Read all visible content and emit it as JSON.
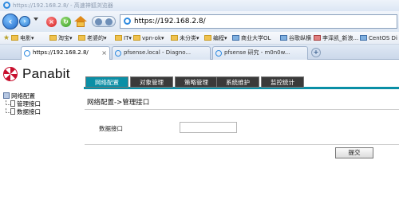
{
  "window": {
    "title": "https://192.168.2.8/ - 高速神狐浏览器"
  },
  "nav": {
    "address": "https://192.168.2.8/"
  },
  "bookmarks": [
    {
      "label": "电影",
      "type": "folder"
    },
    {
      "label": "淘宝",
      "type": "folder"
    },
    {
      "label": "老婆的",
      "type": "folder"
    },
    {
      "label": "IT",
      "type": "folder"
    },
    {
      "label": "vpn-ok",
      "type": "folder"
    },
    {
      "label": "未分类",
      "type": "folder"
    },
    {
      "label": "编程",
      "type": "folder"
    },
    {
      "label": "商业大学OL",
      "type": "link"
    },
    {
      "label": "谷歌纵横",
      "type": "link"
    },
    {
      "label": "李泽凯_新浪...",
      "type": "link"
    },
    {
      "label": "CentOS Di",
      "type": "link"
    }
  ],
  "tabs": [
    {
      "label": "https://192.168.2.8/",
      "active": true
    },
    {
      "label": "pfsense.local - Diagno...",
      "active": false
    },
    {
      "label": "pfsense 研究 - m0n0w...",
      "active": false
    }
  ],
  "app": {
    "logo_text": "Panabit",
    "menu": [
      {
        "label": "网络配置",
        "active": true
      },
      {
        "label": "对象管理",
        "active": false
      },
      {
        "label": "策略管理",
        "active": false
      },
      {
        "label": "系统维护",
        "active": false
      },
      {
        "label": "监控统计",
        "active": false
      }
    ],
    "sidebar": {
      "root": "网络配置",
      "items": [
        "管理接口",
        "数据接口"
      ]
    },
    "content": {
      "title": "网络配置->管理接口",
      "field_label": "数据接口",
      "field_value": "",
      "submit_label": "提交"
    }
  }
}
